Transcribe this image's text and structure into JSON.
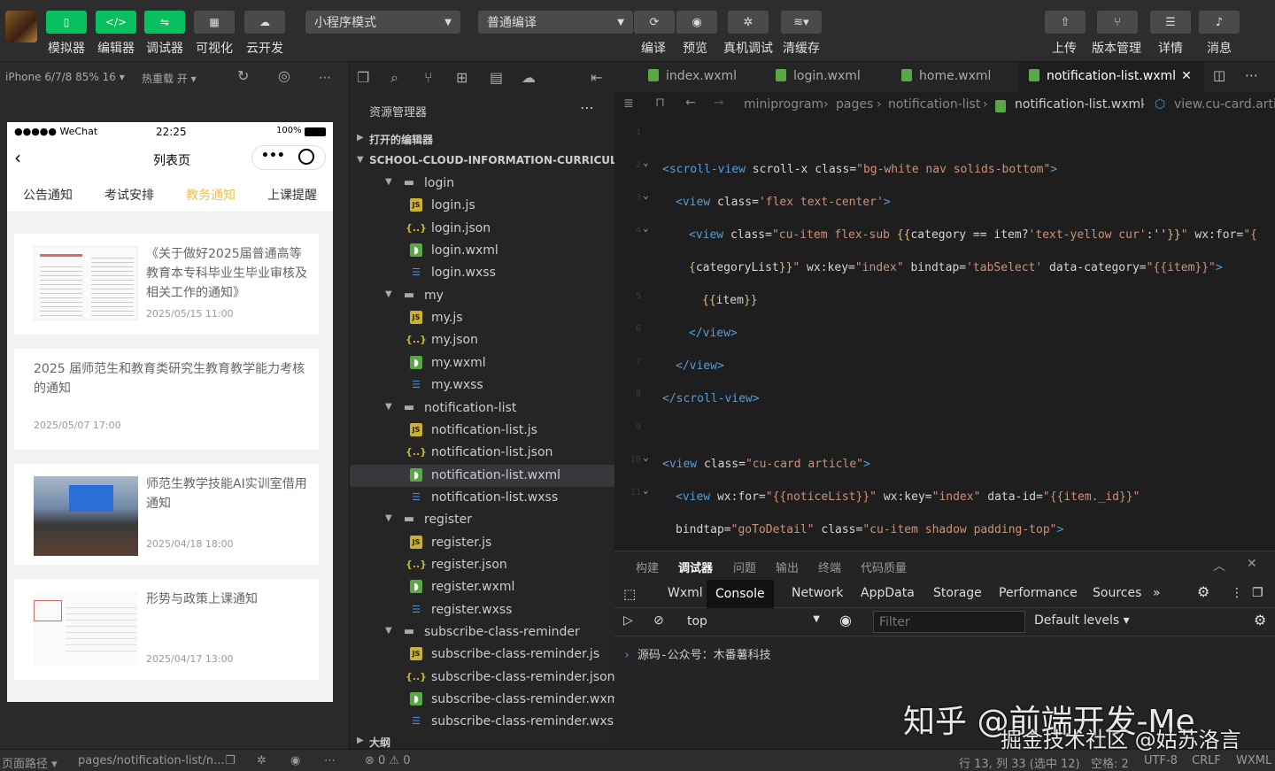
{
  "toolbar": {
    "left_buttons": [
      {
        "label": "模拟器",
        "icon": "phone-icon"
      },
      {
        "label": "编辑器",
        "icon": "code-icon"
      },
      {
        "label": "调试器",
        "icon": "debug-icon"
      },
      {
        "label": "可视化",
        "icon": "layout-icon"
      },
      {
        "label": "云开发",
        "icon": "cloud-icon"
      }
    ],
    "mode_select": "小程序模式",
    "compile_select": "普通编译",
    "mid_buttons": [
      {
        "label": "编译"
      },
      {
        "label": "预览"
      },
      {
        "label": "真机调试"
      },
      {
        "label": "清缓存"
      }
    ],
    "right_buttons": [
      {
        "label": "上传"
      },
      {
        "label": "版本管理"
      },
      {
        "label": "详情"
      },
      {
        "label": "消息"
      }
    ]
  },
  "simbar": {
    "device": "iPhone 6/7/8 85% 16 ▾",
    "hot_reload": "热重载 开 ▾"
  },
  "phone": {
    "carrier": "●●●●● WeChat",
    "time": "22:25",
    "battery": "100%",
    "nav_title": "列表页",
    "tabs": [
      "公告通知",
      "考试安排",
      "教务通知",
      "上课提醒"
    ],
    "active_tab": 2,
    "cards": [
      {
        "title": "《关于做好2025届普通高等教育本专科毕业生毕业审核及相关工作的通知》",
        "date": "2025/05/15 11:00",
        "has_thumb": true
      },
      {
        "title": "2025 届师范生和教育类研究生教育教学能力考核的通知",
        "date": "2025/05/07 17:00",
        "has_thumb": false
      },
      {
        "title": "师范生教学技能AI实训室借用通知",
        "date": "2025/04/18 18:00",
        "has_thumb": true
      },
      {
        "title": "形势与政策上课通知",
        "date": "2025/04/17 13:00",
        "has_thumb": true
      }
    ]
  },
  "explorer": {
    "title": "资源管理器",
    "open_editors": "打开的编辑器",
    "project": "SCHOOL-CLOUD-INFORMATION-CURRICUL...",
    "outline": "大纲",
    "tree": [
      {
        "type": "folder",
        "name": "login",
        "depth": 1
      },
      {
        "type": "js",
        "name": "login.js",
        "depth": 2
      },
      {
        "type": "json",
        "name": "login.json",
        "depth": 2
      },
      {
        "type": "wxml",
        "name": "login.wxml",
        "depth": 2
      },
      {
        "type": "wxss",
        "name": "login.wxss",
        "depth": 2
      },
      {
        "type": "folder",
        "name": "my",
        "depth": 1
      },
      {
        "type": "js",
        "name": "my.js",
        "depth": 2
      },
      {
        "type": "json",
        "name": "my.json",
        "depth": 2
      },
      {
        "type": "wxml",
        "name": "my.wxml",
        "depth": 2
      },
      {
        "type": "wxss",
        "name": "my.wxss",
        "depth": 2
      },
      {
        "type": "folder",
        "name": "notification-list",
        "depth": 1
      },
      {
        "type": "js",
        "name": "notification-list.js",
        "depth": 2
      },
      {
        "type": "json",
        "name": "notification-list.json",
        "depth": 2
      },
      {
        "type": "wxml",
        "name": "notification-list.wxml",
        "depth": 2,
        "selected": true
      },
      {
        "type": "wxss",
        "name": "notification-list.wxss",
        "depth": 2
      },
      {
        "type": "folder",
        "name": "register",
        "depth": 1
      },
      {
        "type": "js",
        "name": "register.js",
        "depth": 2
      },
      {
        "type": "json",
        "name": "register.json",
        "depth": 2
      },
      {
        "type": "wxml",
        "name": "register.wxml",
        "depth": 2
      },
      {
        "type": "wxss",
        "name": "register.wxss",
        "depth": 2
      },
      {
        "type": "folder",
        "name": "subscribe-class-reminder",
        "depth": 1
      },
      {
        "type": "js",
        "name": "subscribe-class-reminder.js",
        "depth": 2
      },
      {
        "type": "json",
        "name": "subscribe-class-reminder.json",
        "depth": 2
      },
      {
        "type": "wxml",
        "name": "subscribe-class-reminder.wxml",
        "depth": 2
      },
      {
        "type": "wxss",
        "name": "subscribe-class-reminder.wxss",
        "depth": 2
      }
    ]
  },
  "editor": {
    "tabs": [
      "index.wxml",
      "login.wxml",
      "home.wxml",
      "notification-list.wxml"
    ],
    "active_tab": 3,
    "breadcrumb": [
      "miniprogram",
      "pages",
      "notification-list",
      "notification-list.wxml",
      "view.cu-card.artic"
    ],
    "lines": [
      {
        "n": "1",
        "fold": false,
        "indent": 0,
        "parts": []
      },
      {
        "n": "2",
        "fold": true,
        "indent": 0,
        "parts": [
          [
            "t",
            "<scroll-view "
          ],
          [
            "a",
            "scroll-x class="
          ],
          [
            "v",
            "\"bg-white nav solids-bottom\""
          ],
          [
            "t",
            ">"
          ]
        ]
      },
      {
        "n": "3",
        "fold": true,
        "indent": 1,
        "parts": [
          [
            "t",
            "<view "
          ],
          [
            "a",
            "class="
          ],
          [
            "v",
            "'flex text-center'"
          ],
          [
            "t",
            ">"
          ]
        ]
      },
      {
        "n": "4",
        "fold": true,
        "indent": 2,
        "parts": [
          [
            "t",
            "<view "
          ],
          [
            "a",
            "class="
          ],
          [
            "v",
            "\"cu-item flex-sub "
          ],
          [
            "m",
            "{{"
          ],
          [
            "p",
            "category == item?"
          ],
          [
            "v",
            "'text-yellow cur'"
          ],
          [
            "p",
            ":''"
          ],
          [
            "m",
            "}}"
          ],
          [
            "v",
            "\""
          ],
          [
            "a",
            " wx:for="
          ],
          [
            "v",
            "\"{"
          ]
        ]
      },
      {
        "n": "",
        "fold": false,
        "indent": 2,
        "parts": [
          [
            "m",
            "{"
          ],
          [
            "p",
            "categoryList"
          ],
          [
            "m",
            "}}"
          ],
          [
            "v",
            "\""
          ],
          [
            "a",
            " wx:key="
          ],
          [
            "v",
            "\"index\""
          ],
          [
            "a",
            " bindtap="
          ],
          [
            "v",
            "'tabSelect'"
          ],
          [
            "a",
            " data-category="
          ],
          [
            "v",
            "\"{{item}}\""
          ],
          [
            "t",
            ">"
          ]
        ]
      },
      {
        "n": "5",
        "fold": false,
        "indent": 3,
        "parts": [
          [
            "m",
            "{{"
          ],
          [
            "p",
            "item"
          ],
          [
            "m",
            "}}"
          ]
        ]
      },
      {
        "n": "6",
        "fold": false,
        "indent": 2,
        "parts": [
          [
            "t",
            "</view>"
          ]
        ]
      },
      {
        "n": "7",
        "fold": false,
        "indent": 1,
        "parts": [
          [
            "t",
            "</view>"
          ]
        ]
      },
      {
        "n": "8",
        "fold": false,
        "indent": 0,
        "parts": [
          [
            "t",
            "</scroll-view>"
          ]
        ]
      },
      {
        "n": "9",
        "fold": false,
        "indent": 0,
        "parts": []
      },
      {
        "n": "10",
        "fold": true,
        "indent": 0,
        "parts": [
          [
            "t",
            "<view "
          ],
          [
            "a",
            "class="
          ],
          [
            "v",
            "\"cu-card article\""
          ],
          [
            "t",
            ">"
          ]
        ]
      },
      {
        "n": "11",
        "fold": true,
        "indent": 1,
        "parts": [
          [
            "t",
            "<view "
          ],
          [
            "a",
            "wx:for="
          ],
          [
            "v",
            "\"{{noticeList}}\""
          ],
          [
            "a",
            " wx:key="
          ],
          [
            "v",
            "\"index\""
          ],
          [
            "a",
            " data-id="
          ],
          [
            "v",
            "\"{{item._id}}\""
          ]
        ]
      },
      {
        "n": "",
        "fold": false,
        "indent": 1,
        "parts": [
          [
            "a",
            "bindtap="
          ],
          [
            "v",
            "\"goToDetail\""
          ],
          [
            "a",
            " class="
          ],
          [
            "v",
            "\"cu-item shadow padding-top\""
          ],
          [
            "t",
            ">"
          ]
        ]
      }
    ]
  },
  "devtools": {
    "top_tabs": [
      "构建",
      "调试器",
      "问题",
      "输出",
      "终端",
      "代码质量"
    ],
    "active_top": 1,
    "panel_tabs": [
      "Wxml",
      "Console",
      "Network",
      "AppData",
      "Storage",
      "Performance",
      "Sources"
    ],
    "active_panel": 1,
    "context": "top",
    "filter_placeholder": "Filter",
    "levels": "Default levels ▾",
    "console_text": "源码-公众号：木番薯科技"
  },
  "statusbar": {
    "page_path_label": "页面路径 ▾",
    "page_path": "pages/notification-list/n...",
    "errors": "⊗ 0 ⚠ 0",
    "position": "行 13, 列 33 (选中 12)",
    "spaces": "空格: 2",
    "encoding": "UTF-8",
    "eol": "CRLF",
    "lang": "WXML"
  },
  "watermark": {
    "line1": "知乎 @前端开发-Me",
    "line2": "掘金技术社区 @姑苏洛言"
  }
}
